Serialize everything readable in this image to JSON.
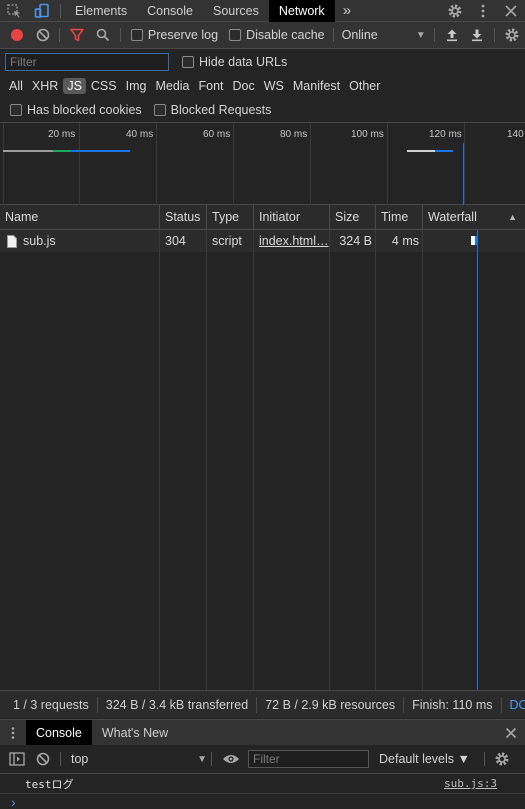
{
  "devtools": {
    "tabs": [
      {
        "label": "Elements"
      },
      {
        "label": "Console"
      },
      {
        "label": "Sources"
      },
      {
        "label": "Network",
        "active": true
      }
    ],
    "more_tabs": "»"
  },
  "toolbar": {
    "preserve_log": "Preserve log",
    "disable_cache": "Disable cache",
    "throttling": "Online"
  },
  "filter": {
    "placeholder": "Filter",
    "hide_data_urls": "Hide data URLs",
    "types": [
      "All",
      "XHR",
      "JS",
      "CSS",
      "Img",
      "Media",
      "Font",
      "Doc",
      "WS",
      "Manifest",
      "Other"
    ],
    "active_type": "JS",
    "has_blocked_cookies": "Has blocked cookies",
    "blocked_requests": "Blocked Requests"
  },
  "overview": {
    "ticks": [
      "20 ms",
      "40 ms",
      "60 ms",
      "80 ms",
      "100 ms",
      "120 ms",
      "140"
    ]
  },
  "table": {
    "headers": {
      "name": "Name",
      "status": "Status",
      "type": "Type",
      "initiator": "Initiator",
      "size": "Size",
      "time": "Time",
      "waterfall": "Waterfall"
    },
    "rows": [
      {
        "name": "sub.js",
        "status": "304",
        "type": "script",
        "initiator": "index.html…",
        "size": "324 B",
        "time": "4 ms"
      }
    ]
  },
  "status": {
    "requests": "1 / 3 requests",
    "transferred": "324 B / 3.4 kB transferred",
    "resources": "72 B / 2.9 kB resources",
    "finish": "Finish: 110 ms",
    "dom": "DO"
  },
  "drawer": {
    "tabs": [
      {
        "label": "Console",
        "active": true
      },
      {
        "label": "What's New"
      }
    ],
    "context": "top",
    "filter_placeholder": "Filter",
    "levels": "Default levels ▼",
    "messages": [
      {
        "text": "testログ",
        "source": "sub.js:3"
      }
    ],
    "prompt": "›"
  },
  "colors": {
    "accent": "#1a73e8",
    "record": "#e94444",
    "filter_active": "#e94444"
  }
}
